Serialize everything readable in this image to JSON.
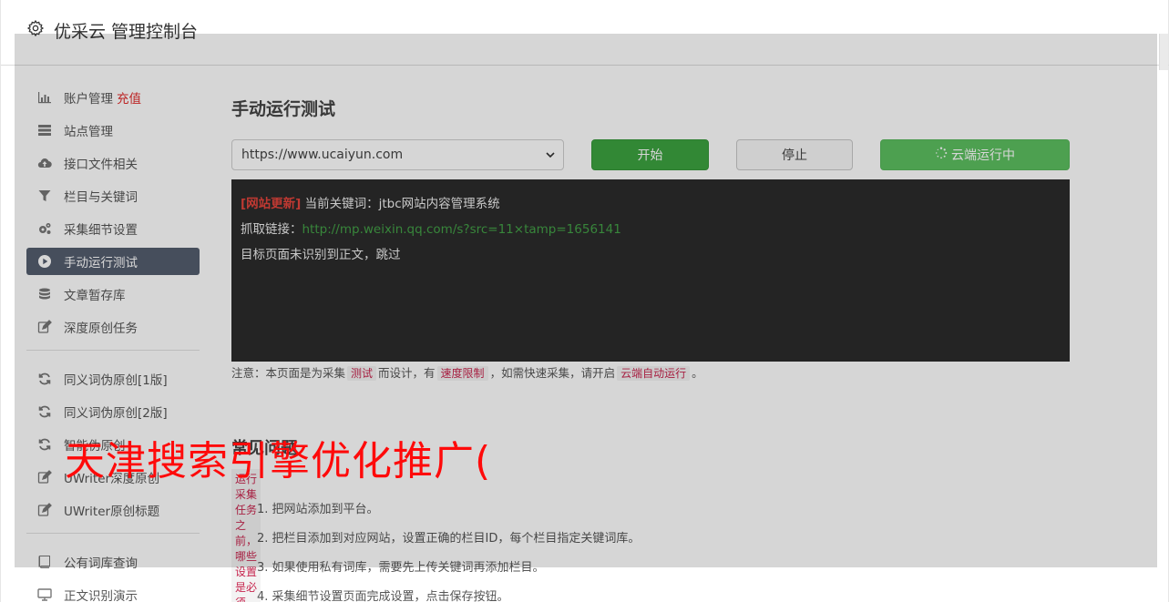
{
  "brand": {
    "title": "优采云 管理控制台",
    "icon": "gear-icon"
  },
  "sidebar": {
    "items": [
      {
        "label": "账户管理",
        "extra": "充值",
        "icon": "bar-chart-icon",
        "active": false
      },
      {
        "label": "站点管理",
        "icon": "server-icon",
        "active": false
      },
      {
        "label": "接口文件相关",
        "icon": "cloud-upload-icon",
        "active": false
      },
      {
        "label": "栏目与关键词",
        "icon": "filter-icon",
        "active": false
      },
      {
        "label": "采集细节设置",
        "icon": "cogs-icon",
        "active": false
      },
      {
        "label": "手动运行测试",
        "icon": "play-circle-icon",
        "active": true
      },
      {
        "label": "文章暂存库",
        "icon": "database-icon",
        "active": false
      },
      {
        "label": "深度原创任务",
        "icon": "edit-icon",
        "active": false
      }
    ],
    "items2": [
      {
        "label": "同义词伪原创[1版]",
        "icon": "refresh-icon"
      },
      {
        "label": "同义词伪原创[2版]",
        "icon": "refresh-icon"
      },
      {
        "label": "智能伪原创",
        "icon": "refresh-icon"
      },
      {
        "label": "UWriter深度原创",
        "icon": "edit-icon"
      },
      {
        "label": "UWriter原创标题",
        "icon": "edit-icon"
      }
    ],
    "items3": [
      {
        "label": "公有词库查询",
        "icon": "book-icon"
      },
      {
        "label": "正文识别演示",
        "icon": "monitor-icon"
      }
    ]
  },
  "main": {
    "title": "手动运行测试",
    "url_select": {
      "value": "https://www.ucaiyun.com"
    },
    "buttons": {
      "start": "开始",
      "stop": "停止",
      "cloud": "云端运行中"
    },
    "console": {
      "line1_tag": "[网站更新]",
      "line1_text": " 当前关键词：jtbc网站内容管理系统",
      "line2_label": "抓取链接：",
      "line2_link": "http://mp.weixin.qq.com/s?src=11×tamp=1656141",
      "line3": "目标页面未识别到正文，跳过"
    },
    "notice": {
      "p1": "注意：本页面是为采集",
      "c1": "测试",
      "p2": "而设计，有",
      "c2": "速度限制",
      "p3": "，如需快速采集，请开启",
      "c3": "云端自动运行",
      "p4": "。"
    },
    "faq": {
      "title": "常见问题",
      "subtitle": "运行采集任务之前，哪些设置是必须的？",
      "items": [
        "1. 把网站添加到平台。",
        "2. 把栏目添加到对应网站，设置正确的栏目ID，每个栏目指定关键词库。",
        "3. 如果使用私有词库，需要先上传关键词再添加栏目。",
        "4. 采集细节设置页面完成设置，点击保存按钮。"
      ]
    }
  },
  "watermark": "天津搜索引擎优化推广(",
  "colors": {
    "active_bg": "#545d6e",
    "start_btn": "#3ca240",
    "cloud_btn": "#5cbf60",
    "console_bg": "#2b2b2b",
    "tag_red": "#e4443c",
    "link_green": "#43a047",
    "watermark_red": "#ff0a0a"
  }
}
